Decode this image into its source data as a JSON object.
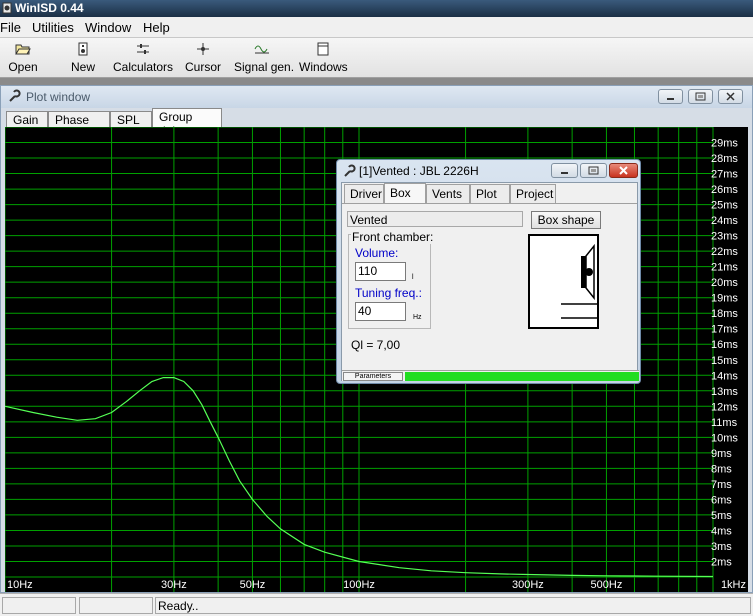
{
  "app": {
    "title": "WinISD 0.44"
  },
  "menu": [
    "File",
    "Utilities",
    "Window",
    "Help"
  ],
  "toolbar": [
    {
      "label": "Open",
      "icon": "open-folder-icon"
    },
    {
      "label": "New",
      "icon": "new-driver-icon"
    },
    {
      "label": "Calculators",
      "icon": "calculators-icon"
    },
    {
      "label": "Cursor",
      "icon": "cursor-crosshair-icon"
    },
    {
      "label": "Signal gen.",
      "icon": "signal-generator-icon"
    },
    {
      "label": "Windows",
      "icon": "windows-icon"
    }
  ],
  "plot_window": {
    "title": "Plot window",
    "tabs": [
      "Gain",
      "Phase plot",
      "SPL",
      "Group delay"
    ],
    "active_tab": "Group delay"
  },
  "box_window": {
    "title": "[1]Vented : JBL 2226H",
    "tabs": [
      "Driver",
      "Box",
      "Vents",
      "Plot",
      "Project"
    ],
    "active_tab": "Box",
    "box_type": "Vented",
    "box_shape_button": "Box shape",
    "front_chamber_label": "Front chamber:",
    "volume_label": "Volume:",
    "volume_value": "110",
    "volume_unit": "l",
    "tuning_label": "Tuning freq.:",
    "tuning_value": "40",
    "tuning_unit": "Hz",
    "ql_text": "Ql = 7,00",
    "progress_label": "Parameters",
    "progress": 1.0
  },
  "status": {
    "text": "Ready.."
  },
  "colors": {
    "plot_bg": "#000000",
    "grid": "#00a000",
    "curve": "#55ff55",
    "axis_text": "#ffffff",
    "progress": "#22dd22"
  },
  "chart_data": {
    "type": "line",
    "xscale": "log",
    "xlim": [
      10,
      1000
    ],
    "ylim": [
      1,
      30
    ],
    "x_tick_labels": [
      "10Hz",
      "30Hz",
      "50Hz",
      "100Hz",
      "300Hz",
      "500Hz",
      "1kHz"
    ],
    "x_tick_values": [
      10,
      30,
      50,
      100,
      300,
      500,
      1000
    ],
    "y_tick_labels": [
      "2ms",
      "3ms",
      "4ms",
      "5ms",
      "6ms",
      "7ms",
      "8ms",
      "9ms",
      "10ms",
      "11ms",
      "12ms",
      "13ms",
      "14ms",
      "15ms",
      "16ms",
      "17ms",
      "18ms",
      "19ms",
      "20ms",
      "21ms",
      "22ms",
      "23ms",
      "24ms",
      "25ms",
      "26ms",
      "27ms",
      "28ms",
      "29ms"
    ],
    "y_tick_values": [
      2,
      3,
      4,
      5,
      6,
      7,
      8,
      9,
      10,
      11,
      12,
      13,
      14,
      15,
      16,
      17,
      18,
      19,
      20,
      21,
      22,
      23,
      24,
      25,
      26,
      27,
      28,
      29
    ],
    "grid": true,
    "series": [
      {
        "x": [
          10,
          12,
          14,
          16,
          18,
          20,
          22,
          24,
          26,
          28,
          30,
          32,
          34,
          36,
          38,
          40,
          43,
          46,
          50,
          55,
          60,
          70,
          80,
          100,
          130,
          160,
          200,
          250,
          300,
          400,
          500,
          700,
          1000
        ],
        "y": [
          12.0,
          11.6,
          11.3,
          11.1,
          11.2,
          11.6,
          12.3,
          13.0,
          13.6,
          13.85,
          13.85,
          13.6,
          13.0,
          12.1,
          11.0,
          10.0,
          8.5,
          7.2,
          6.0,
          4.9,
          4.1,
          3.1,
          2.6,
          2.0,
          1.6,
          1.4,
          1.28,
          1.2,
          1.16,
          1.1,
          1.08,
          1.05,
          1.03
        ]
      }
    ]
  }
}
